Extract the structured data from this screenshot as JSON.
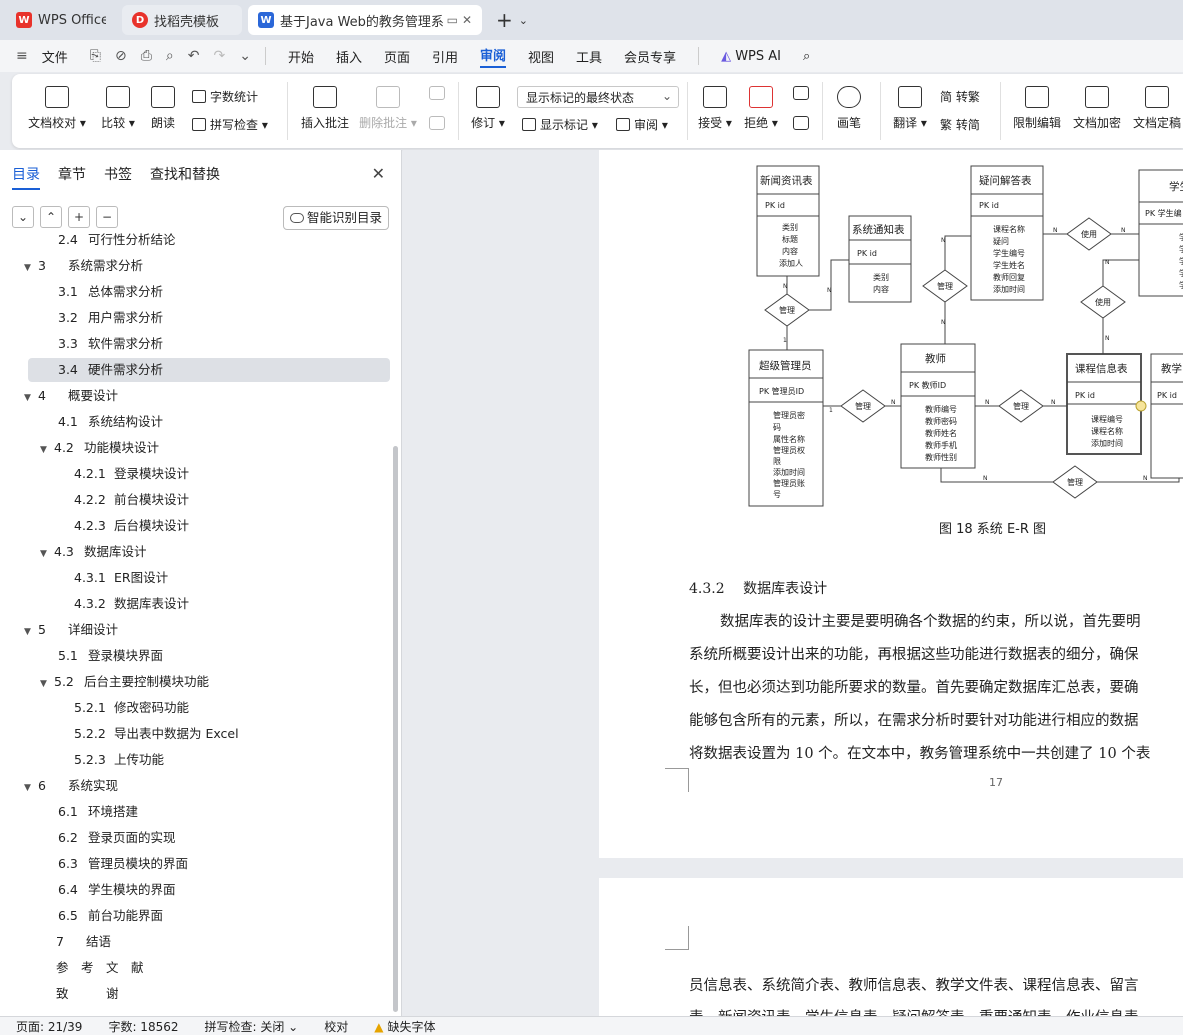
{
  "tabs": [
    {
      "label": "WPS Office",
      "icon": "wps-logo-icon",
      "color": "#e8322b"
    },
    {
      "label": "找稻壳模板",
      "icon": "docer-icon",
      "color": "#e8322b"
    },
    {
      "label": "基于Java Web的教务管理系统",
      "icon": "word-doc-icon",
      "color": "#2b67d8"
    }
  ],
  "menubar": {
    "file": "文件",
    "items": [
      "开始",
      "插入",
      "页面",
      "引用",
      "审阅",
      "视图",
      "工具",
      "会员专享"
    ],
    "active": "审阅",
    "wps_ai": "WPS AI"
  },
  "ribbon": {
    "doc_proof": "文档校对",
    "compare": "比较",
    "read_aloud": "朗读",
    "word_count": "字数统计",
    "spell_check": "拼写检查",
    "insert_comment": "插入批注",
    "delete_comment": "删除批注",
    "revise": "修订",
    "markup_state": "显示标记的最终状态",
    "show_markup": "显示标记",
    "review": "审阅",
    "accept": "接受",
    "reject": "拒绝",
    "pen": "画笔",
    "translate": "翻译",
    "to_traditional": "简 转繁",
    "to_simplified": "繁 转简",
    "restrict_edit": "限制编辑",
    "doc_encrypt": "文档加密",
    "doc_finalize": "文档定稿"
  },
  "navpane": {
    "tabs": [
      "目录",
      "章节",
      "书签",
      "查找和替换"
    ],
    "active_tab": "目录",
    "smart_button": "智能识别目录",
    "toc": [
      {
        "num": "2.4",
        "title": "可行性分析结论",
        "level": 2,
        "partial": true
      },
      {
        "num": "3",
        "title": "系统需求分析",
        "level": 1,
        "arrow": true
      },
      {
        "num": "3.1",
        "title": "总体需求分析",
        "level": 2
      },
      {
        "num": "3.2",
        "title": "用户需求分析",
        "level": 2
      },
      {
        "num": "3.3",
        "title": "软件需求分析",
        "level": 2
      },
      {
        "num": "3.4",
        "title": "硬件需求分析",
        "level": 2,
        "selected": true
      },
      {
        "num": "4",
        "title": "概要设计",
        "level": 1,
        "arrow": true
      },
      {
        "num": "4.1",
        "title": "系统结构设计",
        "level": 2
      },
      {
        "num": "4.2",
        "title": "功能模块设计",
        "level": 2,
        "arrow": true
      },
      {
        "num": "4.2.1",
        "title": "登录模块设计",
        "level": 3
      },
      {
        "num": "4.2.2",
        "title": "前台模块设计",
        "level": 3
      },
      {
        "num": "4.2.3",
        "title": "后台模块设计",
        "level": 3
      },
      {
        "num": "4.3",
        "title": "数据库设计",
        "level": 2,
        "arrow": true
      },
      {
        "num": "4.3.1",
        "title": "ER图设计",
        "level": 3
      },
      {
        "num": "4.3.2",
        "title": "数据库表设计",
        "level": 3
      },
      {
        "num": "5",
        "title": "详细设计",
        "level": 1,
        "arrow": true
      },
      {
        "num": "5.1",
        "title": "登录模块界面",
        "level": 2
      },
      {
        "num": "5.2",
        "title": "后台主要控制模块功能",
        "level": 2,
        "arrow": true
      },
      {
        "num": "5.2.1",
        "title": "修改密码功能",
        "level": 3
      },
      {
        "num": "5.2.2",
        "title": "导出表中数据为 Excel",
        "level": 3
      },
      {
        "num": "5.2.3",
        "title": "上传功能",
        "level": 3
      },
      {
        "num": "6",
        "title": "系统实现",
        "level": 1,
        "arrow": true
      },
      {
        "num": "6.1",
        "title": "环境搭建",
        "level": 2
      },
      {
        "num": "6.2",
        "title": "登录页面的实现",
        "level": 2
      },
      {
        "num": "6.3",
        "title": "管理员模块的界面",
        "level": 2
      },
      {
        "num": "6.4",
        "title": "学生模块的界面",
        "level": 2
      },
      {
        "num": "6.5",
        "title": "前台功能界面",
        "level": 2
      },
      {
        "num": "7",
        "title": "结语",
        "level": 1
      },
      {
        "num": "",
        "title": "参　考　文　献",
        "level": 1
      },
      {
        "num": "",
        "title": "致　　　谢",
        "level": 1
      }
    ]
  },
  "document": {
    "er_diagram": {
      "entities": [
        {
          "title": "新闻资讯表",
          "pk": "PK  id",
          "fields": [
            "类别",
            "标题",
            "内容",
            "添加人"
          ]
        },
        {
          "title": "系统通知表",
          "pk": "PK  id",
          "fields": [
            "类别",
            "内容"
          ]
        },
        {
          "title": "疑问解答表",
          "pk": "PK  id",
          "fields": [
            "课程名称",
            "疑问",
            "学生编号",
            "学生姓名",
            "教师回复",
            "添加时间"
          ]
        },
        {
          "title": "学生",
          "pk": "PK  学生编",
          "fields": [
            "学生",
            "学生",
            "学生",
            "学生",
            "学生"
          ]
        },
        {
          "title": "超级管理员",
          "pk": "PK  管理员ID",
          "fields": [
            "管理员密",
            "码",
            "属性名称",
            "管理员权",
            "限",
            "添加时间",
            "管理员账",
            "号"
          ]
        },
        {
          "title": "教师",
          "pk": "PK  教师ID",
          "fields": [
            "教师编号",
            "教师密码",
            "教师姓名",
            "教师手机",
            "教师性别"
          ]
        },
        {
          "title": "课程信息表",
          "pk": "PK  id",
          "fields": [
            "课程编号",
            "课程名称",
            "添加时间"
          ]
        },
        {
          "title": "教学",
          "pk": "PK  id",
          "fields": [
            "课",
            "课",
            "添",
            "文",
            "视"
          ]
        }
      ],
      "relations": [
        "管理",
        "管理",
        "使用",
        "使用",
        "管理",
        "管理",
        "管理"
      ],
      "cardinality": [
        "N",
        "1"
      ]
    },
    "figure_caption": "图 18 系统 E-R 图",
    "section_num": "4.3.2",
    "section_title": "数据库表设计",
    "paragraph_lines": [
      "数据库表的设计主要是要明确各个数据的约束，所以说，首先要明",
      "系统所概要设计出来的功能，再根据这些功能进行数据表的细分，确保",
      "长，但也必须达到功能所要求的数量。首先要确定数据库汇总表，要确",
      "能够包含所有的元素，所以，在需求分析时要针对功能进行相应的数据",
      "将数据表设置为 10 个。在文本中，教务管理系统中一共创建了 10 个表"
    ],
    "page_number": "17",
    "page2_lines": [
      "员信息表、系统简介表、教师信息表、教学文件表、课程信息表、留言",
      "表、新闻资讯表、学生信息表、疑问解答表、重要通知表、作业信息表"
    ]
  },
  "statusbar": {
    "page": "页面: 21/39",
    "words": "字数: 18562",
    "spell": "拼写检查: 关闭",
    "proof": "校对",
    "missing_font": "缺失字体"
  },
  "colors": {
    "accent": "#1a5fd6",
    "warning": "#e6a400"
  }
}
